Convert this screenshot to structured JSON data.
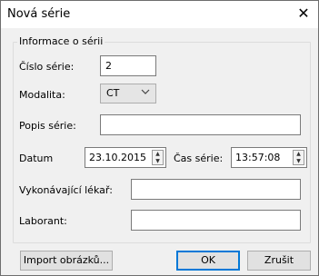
{
  "window": {
    "title": "Nová série",
    "close_glyph": "✕"
  },
  "group": {
    "legend": "Informace o sérii"
  },
  "fields": {
    "cislo_label": "Číslo série:",
    "cislo_value": "2",
    "modalita_label": "Modalita:",
    "modalita_value": "CT",
    "popis_label": "Popis série:",
    "popis_value": "",
    "datum_label": "Datum",
    "datum_value": "23.10.2015",
    "cas_label": "Čas série:",
    "cas_value": "13:57:08",
    "vykonavajici_label": "Vykonávající lékař:",
    "vykonavajici_value": "",
    "laborant_label": "Laborant:",
    "laborant_value": ""
  },
  "buttons": {
    "import_label": "Import obrázků...",
    "ok_label": "OK",
    "cancel_label": "Zrušit"
  },
  "icons": {
    "close": "close-icon",
    "dropdown": "chevron-down-icon",
    "spin_up": "spin-up-icon",
    "spin_down": "spin-down-icon"
  },
  "colors": {
    "dialog_bg": "#f0f0f0",
    "default_button_border": "#0078d7"
  }
}
